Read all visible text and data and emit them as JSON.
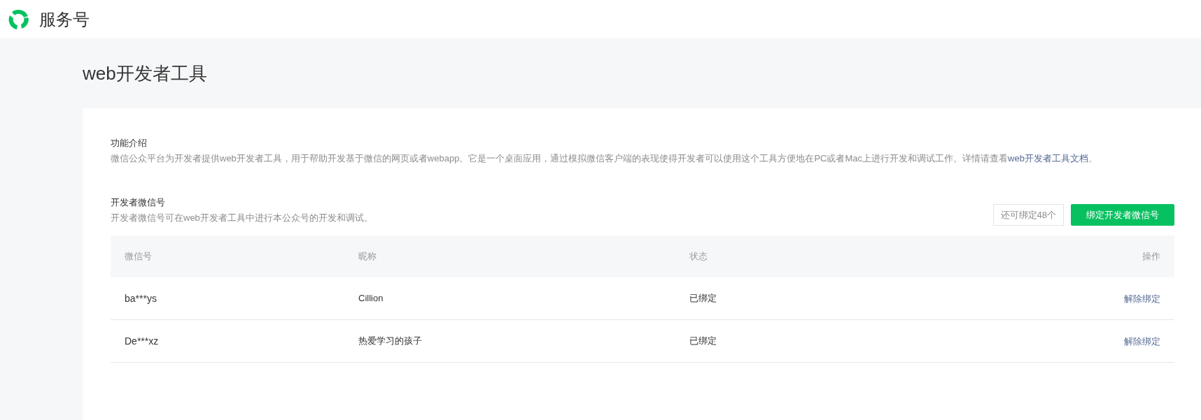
{
  "header": {
    "title": "服务号"
  },
  "page_title": "web开发者工具",
  "intro": {
    "heading": "功能介绍",
    "text": "微信公众平台为开发者提供web开发者工具，用于帮助开发基于微信的网页或者webapp。它是一个桌面应用，通过模拟微信客户端的表现使得开发者可以使用这个工具方便地在PC或者Mac上进行开发和调试工作。详情请查看",
    "link": "web开发者工具文档",
    "after": "。"
  },
  "developers": {
    "heading": "开发者微信号",
    "description": "开发者微信号可在web开发者工具中进行本公众号的开发和调试。",
    "remaining": "还可绑定48个",
    "bind_button": "绑定开发者微信号",
    "table": {
      "columns": [
        "微信号",
        "昵称",
        "状态",
        "操作"
      ],
      "rows": [
        {
          "wechat_id": "ba***ys",
          "nickname": "Cillion",
          "status": "已绑定",
          "action": "解除绑定"
        },
        {
          "wechat_id": "De***xz",
          "nickname": "热爱学习的孩子",
          "status": "已绑定",
          "action": "解除绑定"
        }
      ]
    }
  }
}
